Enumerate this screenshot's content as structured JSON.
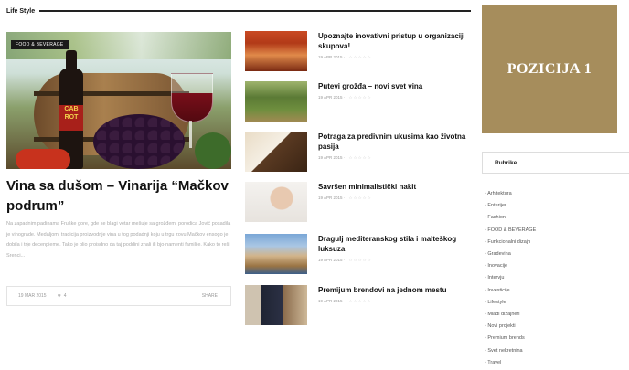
{
  "section": {
    "title": "Life Style"
  },
  "featured": {
    "badge": "FOOD & BEVERAGE",
    "bottle_label": "CAB ROT",
    "title": "Vina sa dušom – Vinarija “Mačkov podrum”",
    "excerpt": "Na zapadnim padinama Fruške gore, gde se blagi vetar mešuje sa grožđem, porodica Jović posadila je vinograde. Medaljom, tradicija proizvodnje vina u tog podadnji koju u trgu zovu Mačkov ensogo je dobila i trje decenpieme. Tako je blio proisdno da taj poddini znali ili bjo-namenti familije. Kako to reši Srenci...",
    "date": "19 MAR 2015",
    "likes": "4",
    "share": "SHARE"
  },
  "posts": [
    {
      "title": "Upoznajte inovativni pristup u organizaciji skupova!",
      "date": "19 APR 2015",
      "stars": "☆☆☆☆☆"
    },
    {
      "title": "Putevi grožđa – novi svet vina",
      "date": "19 APR 2015",
      "stars": "☆☆☆☆☆"
    },
    {
      "title": "Potraga za predivnim ukusima kao životna pasija",
      "date": "19 APR 2015",
      "stars": "☆☆☆☆☆"
    },
    {
      "title": "Savršen minimalistički nakit",
      "date": "19 APR 2015",
      "stars": "☆☆☆☆☆"
    },
    {
      "title": "Dragulj mediteranskog stila i malteškog luksuza",
      "date": "19 APR 2015",
      "stars": "☆☆☆☆☆"
    },
    {
      "title": "Premijum brendovi na jednom mestu",
      "date": "19 APR 2015",
      "stars": "☆☆☆☆☆"
    }
  ],
  "sidebar": {
    "ad_label": "POZICIJA 1",
    "rubrike_label": "Rubrike",
    "categories": [
      "Arhitektura",
      "Enterijer",
      "Fashion",
      "FOOD & BEVERAGE",
      "Funkcionalni dizajn",
      "Gradevina",
      "Inovacije",
      "Intervju",
      "Investicije",
      "Lifestyle",
      "Mladi dizajneri",
      "Novi projekti",
      "Premium brends",
      "Svet nekretnina",
      "Travel"
    ]
  }
}
